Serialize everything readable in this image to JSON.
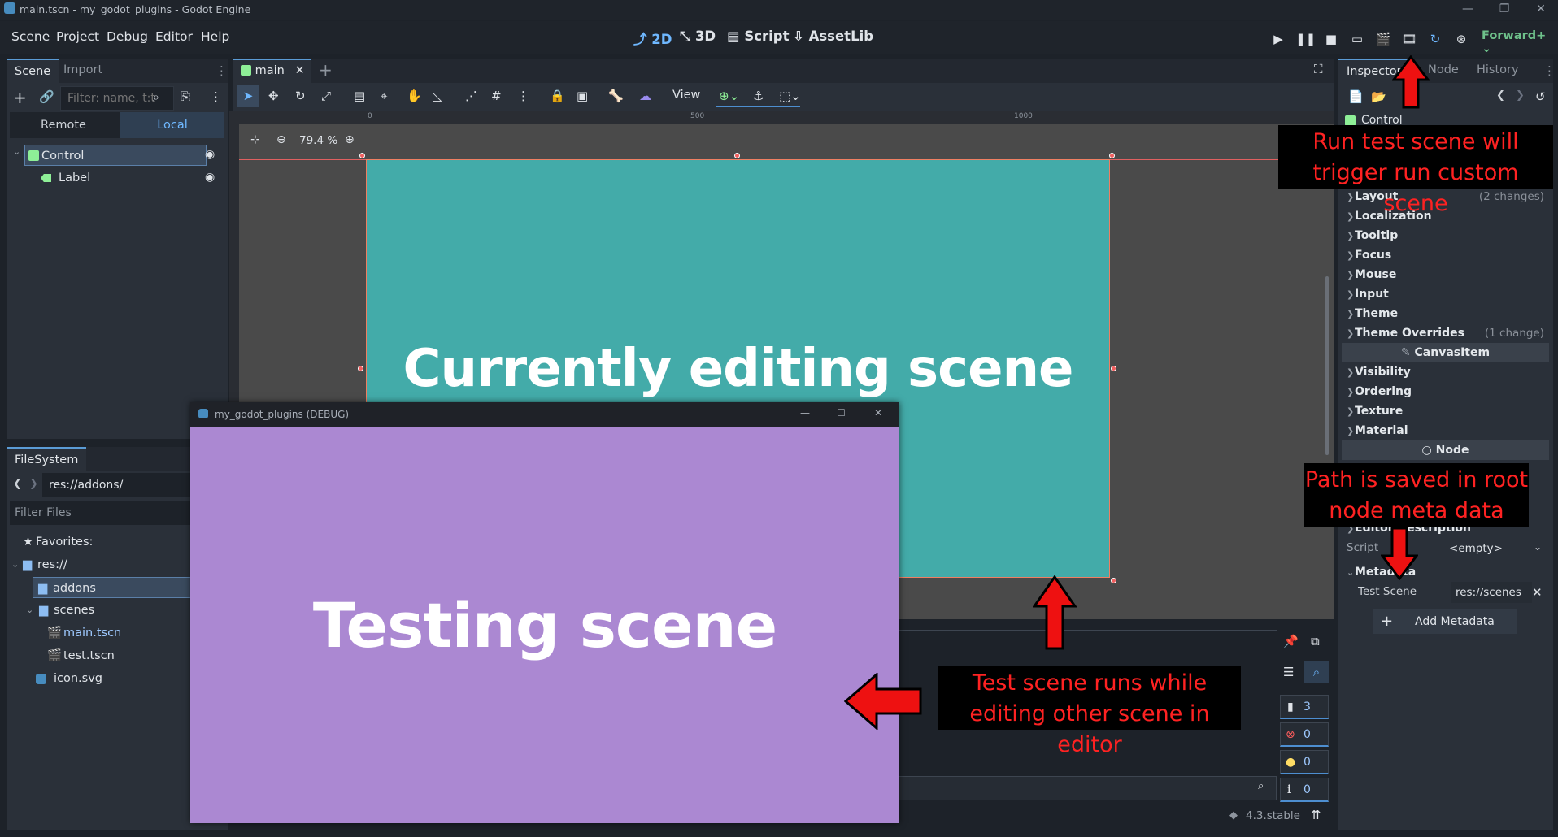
{
  "window": {
    "title": "main.tscn - my_godot_plugins - Godot Engine",
    "controls": [
      "—",
      "❐",
      "✕"
    ]
  },
  "menu": {
    "items": [
      "Scene",
      "Project",
      "Debug",
      "Editor",
      "Help"
    ],
    "workspaces": [
      "2D",
      "3D",
      "Script",
      "AssetLib"
    ],
    "renderer": "Forward+"
  },
  "scene_dock": {
    "tabs": [
      "Scene",
      "Import"
    ],
    "filter_placeholder": "Filter: name, t:t",
    "remote_label": "Remote",
    "local_label": "Local",
    "nodes": [
      {
        "name": "Control"
      },
      {
        "name": "Label"
      }
    ]
  },
  "filesystem": {
    "tab": "FileSystem",
    "path": "res://addons/",
    "filter_placeholder": "Filter Files",
    "tree": [
      {
        "name": "Favorites:"
      },
      {
        "name": "res://"
      },
      {
        "name": "addons"
      },
      {
        "name": "scenes"
      },
      {
        "name": "main.tscn"
      },
      {
        "name": "test.tscn"
      },
      {
        "name": "icon.svg"
      }
    ]
  },
  "editor": {
    "tab_name": "main",
    "view_label": "View",
    "zoom": "79.4 %",
    "ruler_marks": [
      "0",
      "500",
      "1000"
    ],
    "canvas_text": "Currently editing scene"
  },
  "game_window": {
    "title": "my_godot_plugins (DEBUG)",
    "text": "Testing scene"
  },
  "inspector": {
    "tabs": [
      "Inspector",
      "Node",
      "History"
    ],
    "node_type": "Control",
    "properties": [
      {
        "name": "Layout",
        "changes": "(2 changes)"
      },
      {
        "name": "Localization",
        "changes": ""
      },
      {
        "name": "Tooltip",
        "changes": ""
      },
      {
        "name": "Focus",
        "changes": ""
      },
      {
        "name": "Mouse",
        "changes": ""
      },
      {
        "name": "Input",
        "changes": ""
      },
      {
        "name": "Theme",
        "changes": ""
      },
      {
        "name": "Theme Overrides",
        "changes": "(1 change)"
      }
    ],
    "canvas_item_section": "CanvasItem",
    "canvas_item_props": [
      "Visibility",
      "Ordering",
      "Texture",
      "Material"
    ],
    "node_section": "Node",
    "editor_description": "Editor Description",
    "script_label": "Script",
    "script_value": "<empty>",
    "metadata_label": "Metadata",
    "meta_key": "Test Scene",
    "meta_value": "res://scenes",
    "add_metadata": "Add Metadata"
  },
  "bottom_panel": {
    "counts": [
      "3",
      "0",
      "0",
      "0"
    ],
    "version": "4.3.stable"
  },
  "annotations": {
    "run_test": "Run test scene will trigger run custom scene",
    "path_saved": "Path is saved in root node meta data",
    "test_runs": "Test scene runs while editing other scene in editor"
  },
  "colors": {
    "accent": "#6fb8ff",
    "canvas": "#43aba9",
    "game": "#ab88d2",
    "annotation": "#ff2222"
  }
}
